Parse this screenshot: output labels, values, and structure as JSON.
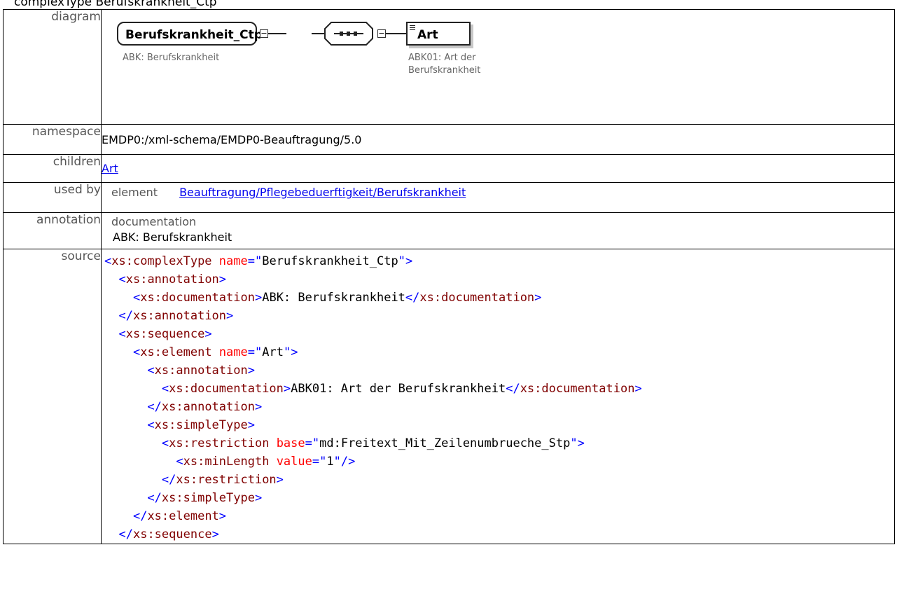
{
  "page_title": "complexType Berufskrankheit_Ctp",
  "labels": {
    "diagram": "diagram",
    "namespace": "namespace",
    "children": "children",
    "used_by": "used by",
    "annotation": "annotation",
    "source": "source"
  },
  "diagram": {
    "complex_type_name": "Berufskrankheit_Ctp",
    "complex_type_caption": "ABK: Berufskrankheit",
    "child_name": "Art",
    "child_caption_line1": "ABK01: Art der",
    "child_caption_line2": "Berufskrankheit"
  },
  "namespace": "EMDP0:/xml-schema/EMDP0-Beauftragung/5.0",
  "children": [
    "Art"
  ],
  "used_by": {
    "kind": "element",
    "link": "Beauftragung/Pflegebeduerftigkeit/Berufskrankheit"
  },
  "annotation": {
    "heading": "documentation",
    "text": "ABK: Berufskrankheit"
  },
  "source_lines": [
    "<xs:complexType name=\"Berufskrankheit_Ctp\">",
    "  <xs:annotation>",
    "    <xs:documentation>ABK: Berufskrankheit</xs:documentation>",
    "  </xs:annotation>",
    "  <xs:sequence>",
    "    <xs:element name=\"Art\">",
    "      <xs:annotation>",
    "        <xs:documentation>ABK01: Art der Berufskrankheit</xs:documentation>",
    "      </xs:annotation>",
    "      <xs:simpleType>",
    "        <xs:restriction base=\"md:Freitext_Mit_Zeilenumbrueche_Stp\">",
    "          <xs:minLength value=\"1\"/>",
    "        </xs:restriction>",
    "      </xs:simpleType>",
    "    </xs:element>",
    "  </xs:sequence>"
  ]
}
